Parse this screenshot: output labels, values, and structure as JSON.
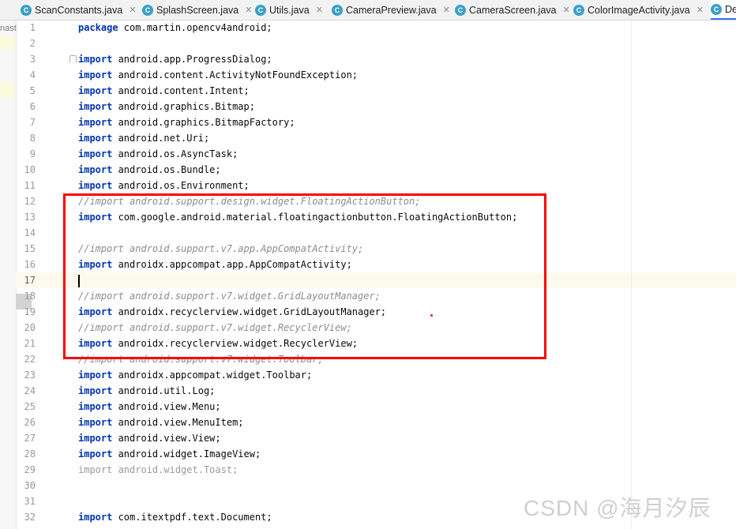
{
  "tabs": [
    {
      "label": "ScanConstants.java"
    },
    {
      "label": "SplashScreen.java"
    },
    {
      "label": "Utils.java"
    },
    {
      "label": "CameraPreview.java"
    },
    {
      "label": "CameraScreen.java"
    },
    {
      "label": "ColorImageActivity.java"
    },
    {
      "label": "De"
    }
  ],
  "tab_icon_letter": "C",
  "close_glyph": "✕",
  "side_label": "nast",
  "code_lines": [
    {
      "n": "1",
      "kind": "kw",
      "kw": "package",
      "rest": " com.martin.opencv4android;"
    },
    {
      "n": "2",
      "kind": "blank"
    },
    {
      "n": "3",
      "kind": "kw",
      "kw": "import",
      "rest": " android.app.ProgressDialog;"
    },
    {
      "n": "4",
      "kind": "kw",
      "kw": "import",
      "rest": " android.content.ActivityNotFoundException;"
    },
    {
      "n": "5",
      "kind": "kw",
      "kw": "import",
      "rest": " android.content.Intent;"
    },
    {
      "n": "6",
      "kind": "kw",
      "kw": "import",
      "rest": " android.graphics.Bitmap;"
    },
    {
      "n": "7",
      "kind": "kw",
      "kw": "import",
      "rest": " android.graphics.BitmapFactory;"
    },
    {
      "n": "8",
      "kind": "kw",
      "kw": "import",
      "rest": " android.net.Uri;"
    },
    {
      "n": "9",
      "kind": "kw",
      "kw": "import",
      "rest": " android.os.AsyncTask;"
    },
    {
      "n": "10",
      "kind": "kw",
      "kw": "import",
      "rest": " android.os.Bundle;"
    },
    {
      "n": "11",
      "kind": "kw",
      "kw": "import",
      "rest": " android.os.Environment;"
    },
    {
      "n": "12",
      "kind": "comment",
      "text": "//import android.support.design.widget.FloatingActionButton;"
    },
    {
      "n": "13",
      "kind": "kw",
      "kw": "import",
      "rest": " com.google.android.material.floatingactionbutton.FloatingActionButton;"
    },
    {
      "n": "14",
      "kind": "blank"
    },
    {
      "n": "15",
      "kind": "comment",
      "text": "//import android.support.v7.app.AppCompatActivity;"
    },
    {
      "n": "16",
      "kind": "kw",
      "kw": "import",
      "rest": " androidx.appcompat.app.AppCompatActivity;"
    },
    {
      "n": "17",
      "kind": "caret"
    },
    {
      "n": "18",
      "kind": "comment",
      "text": "//import android.support.v7.widget.GridLayoutManager;"
    },
    {
      "n": "19",
      "kind": "kw",
      "kw": "import",
      "rest": " androidx.recyclerview.widget.GridLayoutManager;"
    },
    {
      "n": "20",
      "kind": "comment",
      "text": "//import android.support.v7.widget.RecyclerView;"
    },
    {
      "n": "21",
      "kind": "kw",
      "kw": "import",
      "rest": " androidx.recyclerview.widget.RecyclerView;"
    },
    {
      "n": "22",
      "kind": "comment",
      "text": "//import android.support.v7.widget.Toolbar;"
    },
    {
      "n": "23",
      "kind": "kw",
      "kw": "import",
      "rest": " androidx.appcompat.widget.Toolbar;"
    },
    {
      "n": "24",
      "kind": "kw",
      "kw": "import",
      "rest": " android.util.Log;"
    },
    {
      "n": "25",
      "kind": "kw",
      "kw": "import",
      "rest": " android.view.Menu;"
    },
    {
      "n": "26",
      "kind": "kw",
      "kw": "import",
      "rest": " android.view.MenuItem;"
    },
    {
      "n": "27",
      "kind": "kw",
      "kw": "import",
      "rest": " android.view.View;"
    },
    {
      "n": "28",
      "kind": "kw",
      "kw": "import",
      "rest": " android.widget.ImageView;"
    },
    {
      "n": "29",
      "kind": "unused",
      "text": "import android.widget.Toast;"
    },
    {
      "n": "30",
      "kind": "blank"
    },
    {
      "n": "31",
      "kind": "blank"
    },
    {
      "n": "32",
      "kind": "kw",
      "kw": "import",
      "rest": " com.itextpdf.text.Document;"
    }
  ],
  "watermark": "CSDN @海月汐辰",
  "colors": {
    "keyword": "#0033b3",
    "comment": "#8c8c8c",
    "highlight_box": "#ff0000",
    "active_tab_underline": "#3574f0"
  },
  "icons": {
    "tab_icon": "java-class-icon",
    "close": "close-icon",
    "fold": "fold-marker-icon"
  }
}
